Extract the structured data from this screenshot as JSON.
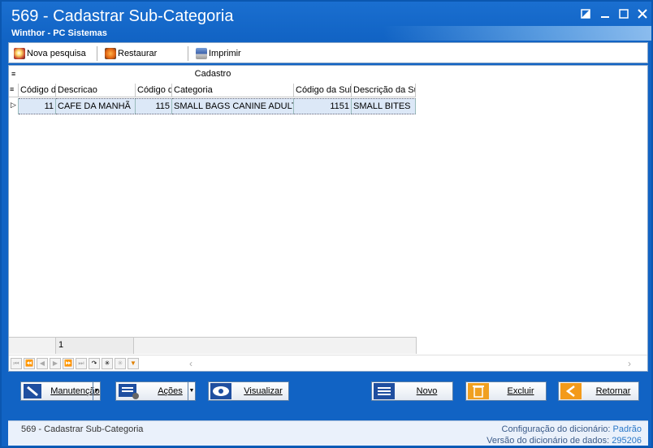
{
  "window": {
    "title": "569 - Cadastrar Sub-Categoria",
    "subtitle": "Winthor - PC Sistemas",
    "controls": [
      "restore-down",
      "minimize",
      "maximize",
      "close"
    ]
  },
  "toolbar": {
    "items": [
      {
        "label": "Nova pesquisa",
        "icon": "search-globe-icon"
      },
      {
        "label": "Restaurar",
        "icon": "restore-icon"
      },
      {
        "label": "Imprimir",
        "icon": "printer-icon"
      }
    ]
  },
  "grid": {
    "group_title": "Cadastro",
    "columns": [
      "Código d",
      "Descricao",
      "Código d",
      "Categoria",
      "Código da Sul",
      "Descrição da Su"
    ],
    "rows": [
      [
        "11",
        "CAFE DA MANHÃ",
        "115",
        "SMALL BAGS CANINE ADULT",
        "1151",
        "SMALL BITES"
      ]
    ],
    "footer_count": "1"
  },
  "buttons": {
    "manutencao": "Manutenção",
    "acoes": "Ações",
    "visualizar": "Visualizar",
    "novo": "Novo",
    "excluir": "Excluir",
    "retornar": "Retornar"
  },
  "status": {
    "left": "569 - Cadastrar Sub-Categoria",
    "config_label": "Configuração do dicionário:",
    "config_value": "Padrão",
    "version_label": "Versão do dicionário de dados:",
    "version_value": "295206"
  },
  "colors": {
    "title_bar": "#1163c4",
    "row_selected": "#dce8f7",
    "novo_icon": "#1f4fa0",
    "excluir_icon": "#f0a020",
    "retornar_icon": "#f39a1a"
  }
}
